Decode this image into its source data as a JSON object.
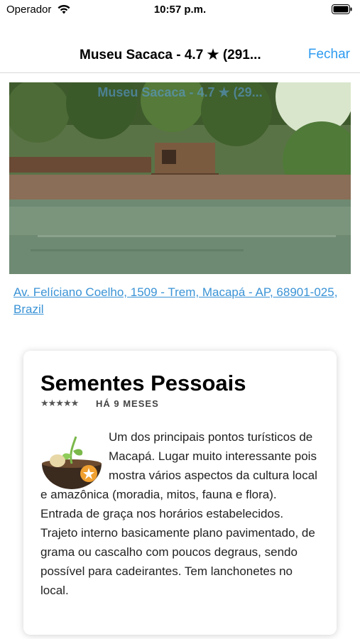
{
  "status_bar": {
    "carrier": "Operador",
    "time": "10:57 p.m."
  },
  "nav": {
    "title": "Museu Sacaca - 4.7 ★ (291...",
    "close_label": "Fechar"
  },
  "photo": {
    "overlay_title": "Museu Sacaca - 4.7 ★ (29..."
  },
  "place": {
    "address": "Av. Felíciano Coelho, 1509 - Trem, Macapá - AP, 68901-025, Brazil"
  },
  "review": {
    "author": "Sementes Pessoais",
    "rating": 5,
    "stars": "★★★★★",
    "time_ago": "HÁ 9 MESES",
    "text": "Um dos principais pontos turísticos de Macapá. Lugar muito interessante pois mostra vários aspectos da cultura local e amazônica (moradia, mitos, fauna e flora). Entrada de graça nos horários estabelecidos. Trajeto interno basicamente plano pavimentado, de grama ou cascalho com poucos degraus, sendo possível para cadeirantes. Tem lanchonetes no local."
  },
  "colors": {
    "link": "#3a93d6",
    "nav_button": "#2e9bf0"
  }
}
